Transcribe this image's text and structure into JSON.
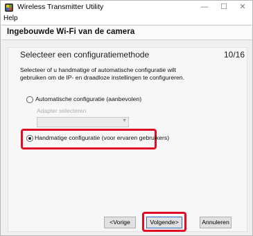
{
  "window": {
    "title": "Wireless Transmitter Utility",
    "app_icon": "app-icon",
    "controls": {
      "minimize": "—",
      "maximize": "☐",
      "close": "✕"
    }
  },
  "menu": {
    "help": "Help"
  },
  "header": {
    "title": "Ingebouwde Wi-Fi van de camera"
  },
  "step": {
    "title": "Selecteer een configuratiemethode",
    "counter": "10/16",
    "description": "Selecteer of u handmatige of automatische configuratie wilt gebruiken om de IP- en draadloze instellingen te configureren."
  },
  "options": {
    "auto": {
      "label": "Automatische configuratie (aanbevolen)",
      "selected": false
    },
    "adapter": {
      "label": "Adapter selecteren",
      "value": ""
    },
    "manual": {
      "label": "Handmatige configuratie (voor ervaren gebruikers)",
      "selected": true
    }
  },
  "buttons": {
    "prev": "<Vorige",
    "next": "Volgende>",
    "cancel": "Annuleren"
  },
  "colors": {
    "highlight": "#e00b24",
    "focus": "#2b6cc4"
  }
}
